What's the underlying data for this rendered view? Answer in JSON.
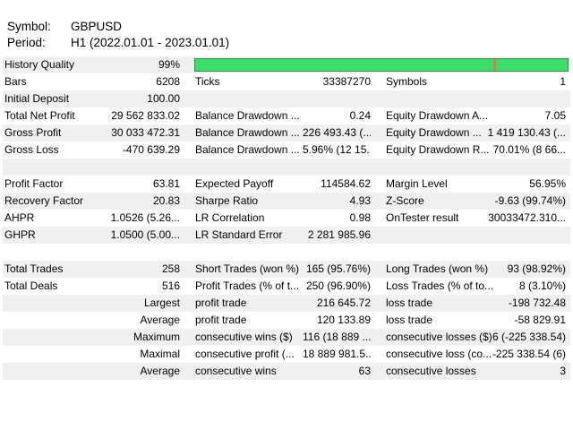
{
  "header": {
    "symbol_label": "Symbol:",
    "symbol_value": "GBPUSD",
    "period_label": "Period:",
    "period_value": "H1 (2022.01.01 - 2023.01.01)"
  },
  "history_quality": {
    "label": "History Quality",
    "value": "99%",
    "fraction": 0.99
  },
  "colors": {
    "quality_bar": "#3ddc6c",
    "quality_marker": "#d6823e",
    "row_shade": "#f0f0f0"
  },
  "stats": [
    {
      "l1": "Bars",
      "v1": "6208",
      "l2": "Ticks",
      "v2": "33387270",
      "l3": "Symbols",
      "v3": "1"
    },
    {
      "l1": "Initial Deposit",
      "v1": "100.00",
      "l2": "",
      "v2": "",
      "l3": "",
      "v3": ""
    },
    {
      "l1": "Total Net Profit",
      "v1": "29 562 833.02",
      "l2": "Balance Drawdown ...",
      "v2": "0.24",
      "l3": "Equity Drawdown A...",
      "v3": "7.05"
    },
    {
      "l1": "Gross Profit",
      "v1": "30 033 472.31",
      "l2": "Balance Drawdown ...",
      "v2": "226 493.43 (...",
      "l3": "Equity Drawdown ...",
      "v3": "1 419 130.43 (..."
    },
    {
      "l1": "Gross Loss",
      "v1": "-470 639.29",
      "l2": "Balance Drawdown ...",
      "v2": "5.96% (12 15...",
      "l3": "Equity Drawdown R...",
      "v3": "70.01% (8 66..."
    },
    {
      "l1": "",
      "v1": "",
      "l2": "",
      "v2": "",
      "l3": "",
      "v3": ""
    },
    {
      "l1": "Profit Factor",
      "v1": "63.81",
      "l2": "Expected Payoff",
      "v2": "114584.62",
      "l3": "Margin Level",
      "v3": "56.95%"
    },
    {
      "l1": "Recovery Factor",
      "v1": "20.83",
      "l2": "Sharpe Ratio",
      "v2": "4.93",
      "l3": "Z-Score",
      "v3": "-9.63 (99.74%)"
    },
    {
      "l1": "AHPR",
      "v1": "1.0526 (5.26...",
      "l2": "LR Correlation",
      "v2": "0.98",
      "l3": "OnTester result",
      "v3": "30033472.310..."
    },
    {
      "l1": "GHPR",
      "v1": "1.0500 (5.00...",
      "l2": "LR Standard Error",
      "v2": "2 281 985.96",
      "l3": "",
      "v3": ""
    },
    {
      "l1": "",
      "v1": "",
      "l2": "",
      "v2": "",
      "l3": "",
      "v3": ""
    },
    {
      "l1": "Total Trades",
      "v1": "258",
      "l2": "Short Trades (won %)",
      "v2": "165 (95.76%)",
      "l3": "Long Trades (won %)",
      "v3": "93 (98.92%)"
    },
    {
      "l1": "Total Deals",
      "v1": "516",
      "l2": "Profit Trades (% of t...",
      "v2": "250 (96.90%)",
      "l3": "Loss Trades (% of to...",
      "v3": "8 (3.10%)"
    },
    {
      "l1": "",
      "v1": "Largest",
      "l2": "profit trade",
      "v2": "216 645.72",
      "l3": "loss trade",
      "v3": "-198 732.48"
    },
    {
      "l1": "",
      "v1": "Average",
      "l2": "profit trade",
      "v2": "120 133.89",
      "l3": "loss trade",
      "v3": "-58 829.91"
    },
    {
      "l1": "",
      "v1": "Maximum",
      "l2": "consecutive wins ($)",
      "v2": "116 (18 889 ...",
      "l3": "consecutive losses ($)",
      "v3": "6 (-225 338.54)"
    },
    {
      "l1": "",
      "v1": "Maximal",
      "l2": "consecutive profit (...",
      "v2": "18 889 981.5...",
      "l3": "consecutive loss (co...",
      "v3": "-225 338.54 (6)"
    },
    {
      "l1": "",
      "v1": "Average",
      "l2": "consecutive wins",
      "v2": "63",
      "l3": "consecutive losses",
      "v3": "3"
    },
    {
      "l1": "",
      "v1": "",
      "l2": "",
      "v2": "",
      "l3": "",
      "v3": ""
    }
  ]
}
